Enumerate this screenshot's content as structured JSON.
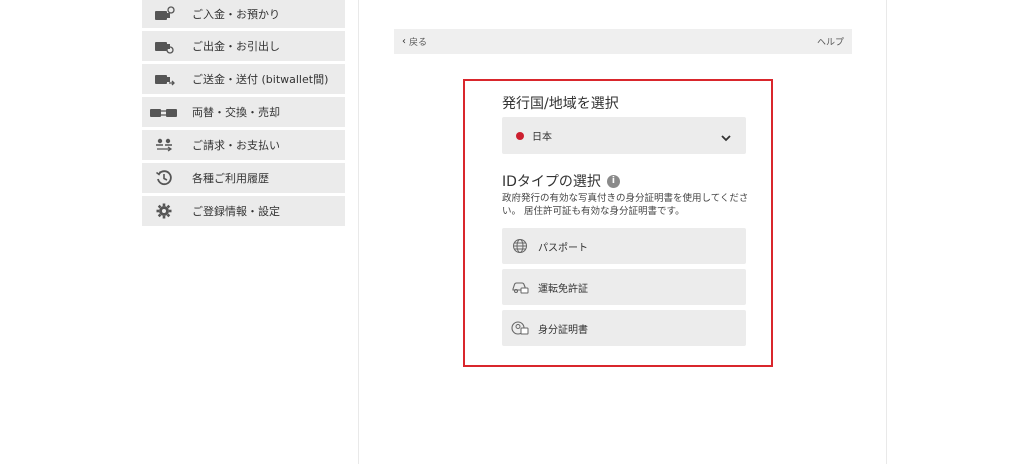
{
  "sidebar": {
    "items": [
      {
        "label": "ご入金・お預かり",
        "icon": "deposit-icon"
      },
      {
        "label": "ご出金・お引出し",
        "icon": "withdraw-icon"
      },
      {
        "label": "ご送金・送付 (bitwallet間)",
        "icon": "transfer-icon"
      },
      {
        "label": "両替・交換・売却",
        "icon": "exchange-icon"
      },
      {
        "label": "ご請求・お支払い",
        "icon": "request-icon"
      },
      {
        "label": "各種ご利用履歴",
        "icon": "history-icon"
      },
      {
        "label": "ご登録情報・設定",
        "icon": "gear-icon"
      }
    ]
  },
  "topbar": {
    "back_label": "戻る",
    "help_label": "ヘルプ"
  },
  "panel": {
    "country_title": "発行国/地域を選択",
    "country_value": "日本",
    "id_title": "IDタイプの選択",
    "id_description": "政府発行の有効な写真付きの身分証明書を使用してください。 居住許可証も有効な身分証明書です。",
    "options": [
      {
        "label": "パスポート",
        "icon": "globe-icon"
      },
      {
        "label": "運転免許証",
        "icon": "car-icon"
      },
      {
        "label": "身分証明書",
        "icon": "id-card-icon"
      }
    ]
  },
  "colors": {
    "highlight_border": "#d9262c",
    "item_background": "#ececec",
    "flag_red": "#cc1f2f"
  }
}
